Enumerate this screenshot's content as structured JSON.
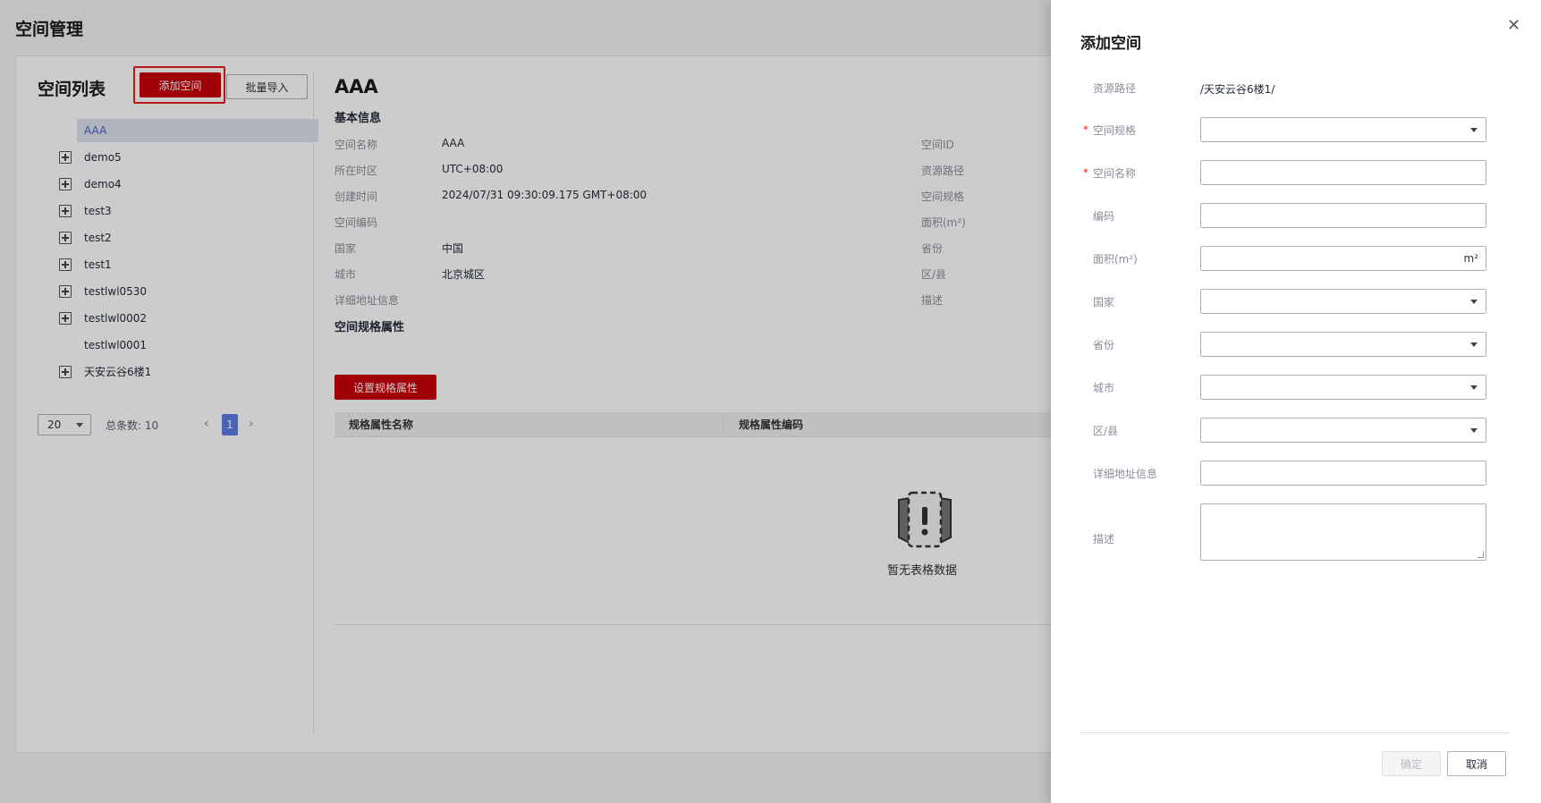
{
  "page": {
    "title": "空间管理"
  },
  "space_list": {
    "title": "空间列表",
    "add_button": "添加空间",
    "import_button": "批量导入",
    "items": [
      {
        "label": "AAA",
        "expandable": false,
        "selected": true
      },
      {
        "label": "demo5",
        "expandable": true
      },
      {
        "label": "demo4",
        "expandable": true
      },
      {
        "label": "test3",
        "expandable": true
      },
      {
        "label": "test2",
        "expandable": true
      },
      {
        "label": "test1",
        "expandable": true
      },
      {
        "label": "testlwl0530",
        "expandable": true
      },
      {
        "label": "testlwl0002",
        "expandable": true
      },
      {
        "label": "testlwl0001",
        "expandable": false
      },
      {
        "label": "天安云谷6楼1",
        "expandable": true
      }
    ],
    "pagination": {
      "page_size": "20",
      "total_label": "总条数: 10",
      "current_page": "1"
    }
  },
  "detail": {
    "title": "AAA",
    "basic_info_title": "基本信息",
    "left_fields": [
      {
        "key": "空间名称",
        "value": "AAA"
      },
      {
        "key": "所在时区",
        "value": "UTC+08:00"
      },
      {
        "key": "创建时间",
        "value": "2024/07/31 09:30:09.175 GMT+08:00"
      },
      {
        "key": "空间编码",
        "value": ""
      },
      {
        "key": "国家",
        "value": "中国"
      },
      {
        "key": "城市",
        "value": "北京城区"
      },
      {
        "key": "详细地址信息",
        "value": ""
      }
    ],
    "right_fields": [
      "空间ID",
      "资源路径",
      "空间规格",
      "面积(m²)",
      "省份",
      "区/县",
      "描述"
    ],
    "spec_section_title": "空间规格属性",
    "spec_button": "设置规格属性",
    "table_headers": [
      "规格属性名称",
      "规格属性编码"
    ],
    "empty_text": "暂无表格数据"
  },
  "drawer": {
    "title": "添加空间",
    "close_icon": "close-icon",
    "fields": {
      "resource_path": {
        "label": "资源路径",
        "value": "/天安云谷6楼1/"
      },
      "space_spec": {
        "label": "空间规格",
        "required": true
      },
      "space_name": {
        "label": "空间名称",
        "required": true
      },
      "code": {
        "label": "编码"
      },
      "area": {
        "label": "面积(m²)",
        "unit": "m²"
      },
      "country": {
        "label": "国家"
      },
      "province": {
        "label": "省份"
      },
      "city": {
        "label": "城市"
      },
      "district": {
        "label": "区/县"
      },
      "address": {
        "label": "详细地址信息"
      },
      "description": {
        "label": "描述"
      }
    },
    "ok_button": "确定",
    "cancel_button": "取消"
  },
  "colors": {
    "brand_red": "#c7000b",
    "highlight_border": "#e02020",
    "pager_active": "#5e7ce0"
  }
}
